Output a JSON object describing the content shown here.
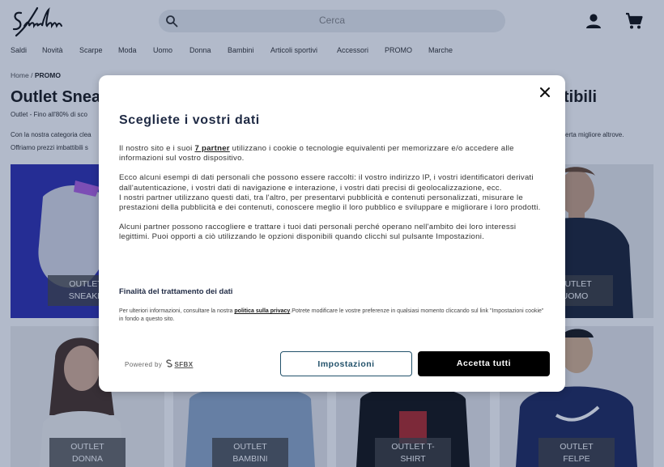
{
  "header": {
    "logo_text": "Sneakin",
    "search_placeholder": "Cerca"
  },
  "nav": [
    "Saldi",
    "Novità",
    "Scarpe",
    "Moda",
    "Uomo",
    "Donna",
    "Bambini",
    "Articoli sportivi",
    "Accessori",
    "PROMO",
    "Marche"
  ],
  "breadcrumb": {
    "home": "Home",
    "sep": "/",
    "current": "PROMO"
  },
  "page": {
    "title_left": "Outlet Sneak",
    "title_right": "tibili",
    "subtitle": "Outlet - Fino all'80% di sco",
    "desc1_left": "Con la nostra categoria clea",
    "desc1_right": "erta migliore altrove.",
    "desc2": "Offriamo prezzi imbattibili s"
  },
  "tiles": [
    {
      "line1": "OUTLET",
      "line2": "SNEAKE"
    },
    {
      "line1": "OUTLET",
      "line2": "UOMO"
    },
    {
      "line1": "OUTLET",
      "line2": "DONNA"
    },
    {
      "line1": "OUTLET",
      "line2": "BAMBINI"
    },
    {
      "line1": "OUTLET T-",
      "line2": "SHIRT"
    },
    {
      "line1": "OUTLET",
      "line2": "FELPE"
    }
  ],
  "modal": {
    "title": "Scegliete i vostri dati",
    "p1_a": "Il nostro sito e i suoi ",
    "p1_link": "7 partner",
    "p1_b": " utilizzano i cookie o tecnologie equivalenti per memorizzare e/o accedere alle informazioni sul vostro dispositivo.",
    "p2": "Ecco alcuni esempi di dati personali che possono essere raccolti: il vostro indirizzo IP, i vostri identificatori derivati dall'autenticazione, i vostri dati di navigazione e interazione, i vostri dati precisi di geolocalizzazione, ecc.",
    "p3": "I nostri partner utilizzano questi dati, tra l'altro, per presentarvi pubblicità e contenuti personalizzati, misurare le prestazioni della pubblicità e dei contenuti, conoscere meglio il loro pubblico e sviluppare e migliorare i loro prodotti.",
    "p4": "Alcuni partner possono raccogliere e trattare i tuoi dati personali perché operano nell'ambito dei loro interessi legittimi. Puoi opporti a ciò utilizzando le opzioni disponibili quando clicchi sul pulsante Impostazioni.",
    "section_title": "Finalità del trattamento dei dati",
    "small_a": "Per ulteriori informazioni, consultare la nostra ",
    "small_link": "politica sulla privacy",
    "small_b": ".Potrete modificare le vostre preferenze in qualsiasi momento cliccando sul link \"Impostazioni cookie\" in fondo a questo sito.",
    "powered_label": "Powered by",
    "powered_brand": "SFBX",
    "settings_button": "Impostazioni",
    "accept_button": "Accetta tutti"
  },
  "colors": {
    "overlay": "#10285a",
    "button_outline": "#23526b",
    "accept_bg": "#000000",
    "title": "#1f2a44"
  }
}
